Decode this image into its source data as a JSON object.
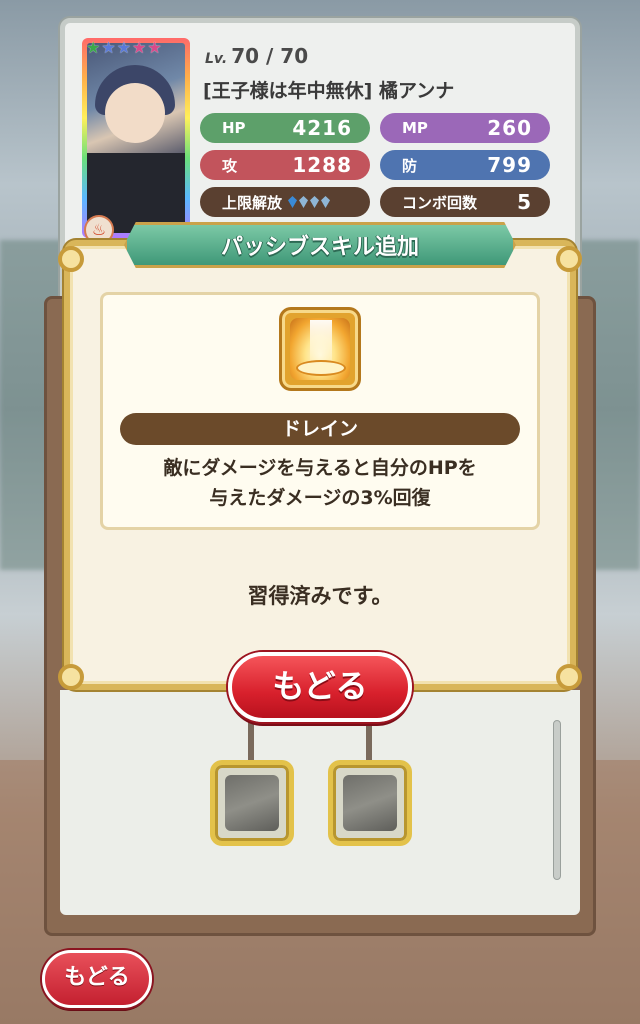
{
  "character": {
    "level_prefix": "Lv.",
    "level": "70 / 70",
    "name": "[王子様は年中無休] 橘アンナ",
    "stars": [
      "#3aa84a",
      "#5a7ad8",
      "#5a7ad8",
      "#d84a8a",
      "#d84a8a"
    ]
  },
  "stats": {
    "hp_label": "HP",
    "hp_value": "4216",
    "mp_label": "MP",
    "mp_value": "260",
    "atk_label": "攻",
    "atk_value": "1288",
    "def_label": "防",
    "def_value": "799",
    "limit_label": "上限解放",
    "combo_label": "コンボ回数",
    "combo_value": "5"
  },
  "modal": {
    "title": "パッシブスキル追加",
    "skill_name": "ドレイン",
    "skill_desc_line1": "敵にダメージを与えると自分のHPを",
    "skill_desc_line2": "与えたダメージの3%回復",
    "status": "習得済みです。",
    "back_button": "もどる"
  },
  "footer": {
    "back_button": "もどる"
  }
}
